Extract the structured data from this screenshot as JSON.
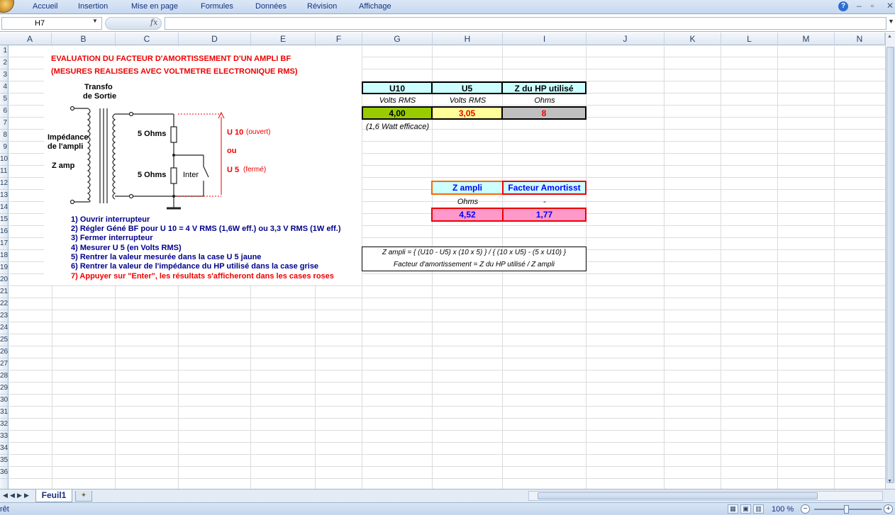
{
  "app": {
    "menu_tabs": [
      "Accueil",
      "Insertion",
      "Mise en page",
      "Formules",
      "Données",
      "Révision",
      "Affichage"
    ]
  },
  "formula_bar": {
    "name_box": "H7",
    "fx_label": "fx",
    "formula": ""
  },
  "columns": [
    "A",
    "B",
    "C",
    "D",
    "E",
    "F",
    "G",
    "H",
    "I",
    "J",
    "K",
    "L",
    "M",
    "N"
  ],
  "rows": [
    "1",
    "2",
    "3",
    "4",
    "5",
    "6",
    "7",
    "8",
    "9",
    "10",
    "11",
    "12",
    "13",
    "14",
    "15",
    "16",
    "17",
    "18",
    "19",
    "20",
    "21",
    "22",
    "23",
    "24",
    "25",
    "26",
    "27",
    "28",
    "29",
    "30",
    "31",
    "32",
    "33",
    "34",
    "35",
    "36"
  ],
  "sheet": {
    "title_line1": "EVALUATION DU FACTEUR D'AMORTISSEMENT D'UN AMPLI BF",
    "title_line2": "(MESURES REALISEES AVEC VOLTMETRE ELECTRONIQUE RMS)",
    "diagram": {
      "transfo": "Transfo",
      "sortie": "de Sortie",
      "imp1": "Impédance",
      "imp2": "de l'ampli",
      "zamp": "Z amp",
      "r1": "5 Ohms",
      "r2": "5 Ohms",
      "inter": "Inter",
      "u10": "U 10",
      "ouvert": "(ouvert)",
      "ou": "ou",
      "u5": "U 5",
      "ferme": "(fermé)"
    },
    "steps": [
      "1)   Ouvrir interrupteur",
      "2)   Régler Géné BF pour U 10 = 4 V RMS  (1,6W eff.) ou 3,3 V RMS (1W eff.)",
      "3)   Fermer interrupteur",
      "4)   Mesurer U 5  (en Volts RMS)",
      "5)   Rentrer la valeur mesurée dans la case U 5 jaune",
      "6)   Rentrer la valeur de l'impédance du HP utilisé  dans la case grise",
      "7)   Appuyer sur \"Enter\", les résultats s'afficheront dans les cases roses"
    ],
    "table1": {
      "headers": [
        "U10",
        "U5",
        "Z du HP utilisé"
      ],
      "units": [
        "Volts RMS",
        "Volts RMS",
        "Ohms"
      ],
      "values": [
        "4,00",
        "3,05",
        "8"
      ],
      "note": "(1,6 Watt efficace)"
    },
    "table2": {
      "headers": [
        "Z ampli",
        "Facteur Amortisst"
      ],
      "units": [
        "Ohms",
        "-"
      ],
      "values": [
        "4,52",
        "1,77"
      ]
    },
    "formulas": [
      "Z ampli  =  { (U10 - U5) x (10 x 5) }  /  { (10 x U5) - (5 x U10) }",
      "Facteur  d'amortissement  =  Z du HP utilisé  /  Z ampli"
    ]
  },
  "sheet_tab": "Feuil1",
  "status": {
    "text": "rêt",
    "zoom": "100 %"
  }
}
